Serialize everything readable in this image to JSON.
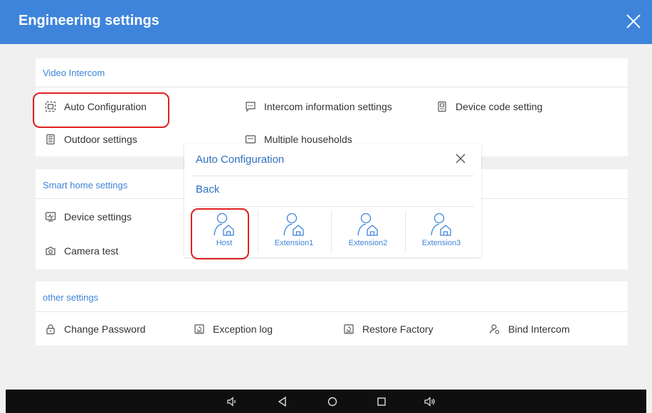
{
  "header": {
    "title": "Engineering settings"
  },
  "video_intercom": {
    "title": "Video Intercom",
    "items": [
      {
        "label": "Auto Configuration",
        "icon": "auto-config-icon"
      },
      {
        "label": "Intercom information settings",
        "icon": "message-icon"
      },
      {
        "label": "Device code setting",
        "icon": "device-code-icon"
      },
      {
        "label": "Outdoor settings",
        "icon": "outdoor-panel-icon"
      },
      {
        "label": "Multiple households",
        "icon": "households-icon"
      }
    ]
  },
  "smart_home": {
    "title": "Smart home settings",
    "items": [
      {
        "label": "Device settings",
        "icon": "device-monitor-icon"
      },
      {
        "label": "Camera test",
        "icon": "camera-icon"
      }
    ]
  },
  "other": {
    "title": "other settings",
    "items": [
      {
        "label": "Change Password",
        "icon": "lock-icon"
      },
      {
        "label": "Exception log",
        "icon": "log-icon"
      },
      {
        "label": "Restore Factory",
        "icon": "restore-icon"
      },
      {
        "label": "Bind Intercom",
        "icon": "bind-user-icon"
      }
    ]
  },
  "modal": {
    "title": "Auto Configuration",
    "back_label": "Back",
    "options": [
      {
        "label": "Host",
        "icon": "user-home-icon"
      },
      {
        "label": "Extension1",
        "icon": "user-home-icon"
      },
      {
        "label": "Extension2",
        "icon": "user-home-icon"
      },
      {
        "label": "Extension3",
        "icon": "user-home-icon"
      }
    ]
  },
  "colors": {
    "accent": "#3e84db",
    "highlight": "#e02020",
    "navbar": "#0f0f0f"
  },
  "navbar_icons": [
    "volume-down-icon",
    "back-icon",
    "home-icon",
    "recents-icon",
    "volume-up-icon"
  ]
}
